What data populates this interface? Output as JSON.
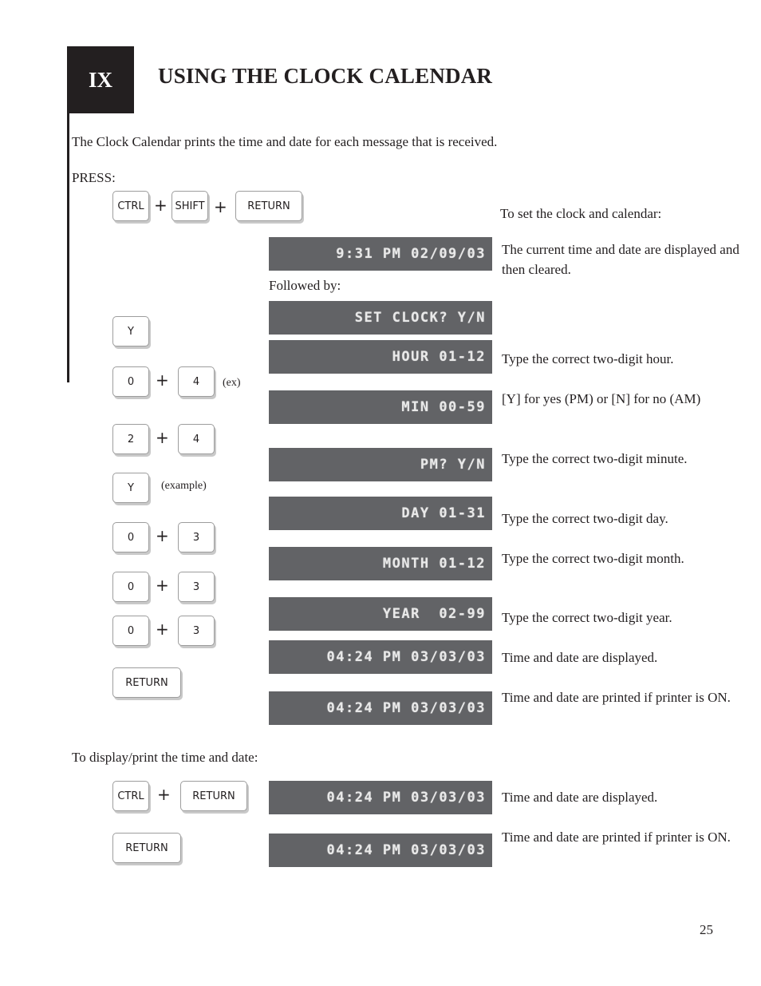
{
  "chapter": {
    "number": "IX",
    "title": "USING THE CLOCK CALENDAR"
  },
  "intro": "The Clock Calendar prints the time and date for each message that is received.",
  "press_label": "PRESS:",
  "set_section": {
    "heading": "To set the clock and calendar:",
    "followed_by": "Followed by:",
    "initial_keys": [
      "CTRL",
      "SHIFT",
      "RETURN"
    ],
    "steps": [
      {
        "display": "9:31 PM 02/09/03",
        "description": "The current time and date are displayed and then cleared."
      },
      {
        "keys": [
          "Y"
        ],
        "display": "SET CLOCK? Y/N",
        "description": ""
      },
      {
        "keys": [
          "0",
          "4"
        ],
        "note": "(ex)",
        "display": "HOUR 01-12",
        "description": "Type the correct two-digit hour."
      },
      {
        "keys": [
          "2",
          "4"
        ],
        "display": "MIN 00-59",
        "description": "[Y] for yes (PM) or [N] for no (AM)"
      },
      {
        "keys": [
          "Y"
        ],
        "note": "(example)",
        "display": "PM? Y/N",
        "description": "Type the correct two-digit minute."
      },
      {
        "keys": [
          "0",
          "3"
        ],
        "display": "DAY 01-31",
        "description": "Type the correct two-digit day."
      },
      {
        "keys": [
          "0",
          "3"
        ],
        "display": "MONTH 01-12",
        "description": "Type the correct two-digit month."
      },
      {
        "keys": [
          "0",
          "3"
        ],
        "display": "YEAR  02-99",
        "description": "Type the correct two-digit year."
      },
      {
        "keys": [
          "RETURN"
        ],
        "display": "04:24 PM 03/03/03",
        "description": "Time and date are displayed."
      },
      {
        "display": "04:24 PM 03/03/03",
        "description": "Time and date are printed if printer is ON."
      }
    ]
  },
  "display_section": {
    "heading": "To display/print the time and date:",
    "steps": [
      {
        "keys": [
          "CTRL",
          "RETURN"
        ],
        "display": "04:24 PM 03/03/03",
        "description": "Time and date are displayed."
      },
      {
        "keys": [
          "RETURN"
        ],
        "display": "04:24 PM 03/03/03",
        "description": "Time and date are printed if printer is ON."
      }
    ]
  },
  "plus_symbol": "+",
  "page_number": "25"
}
